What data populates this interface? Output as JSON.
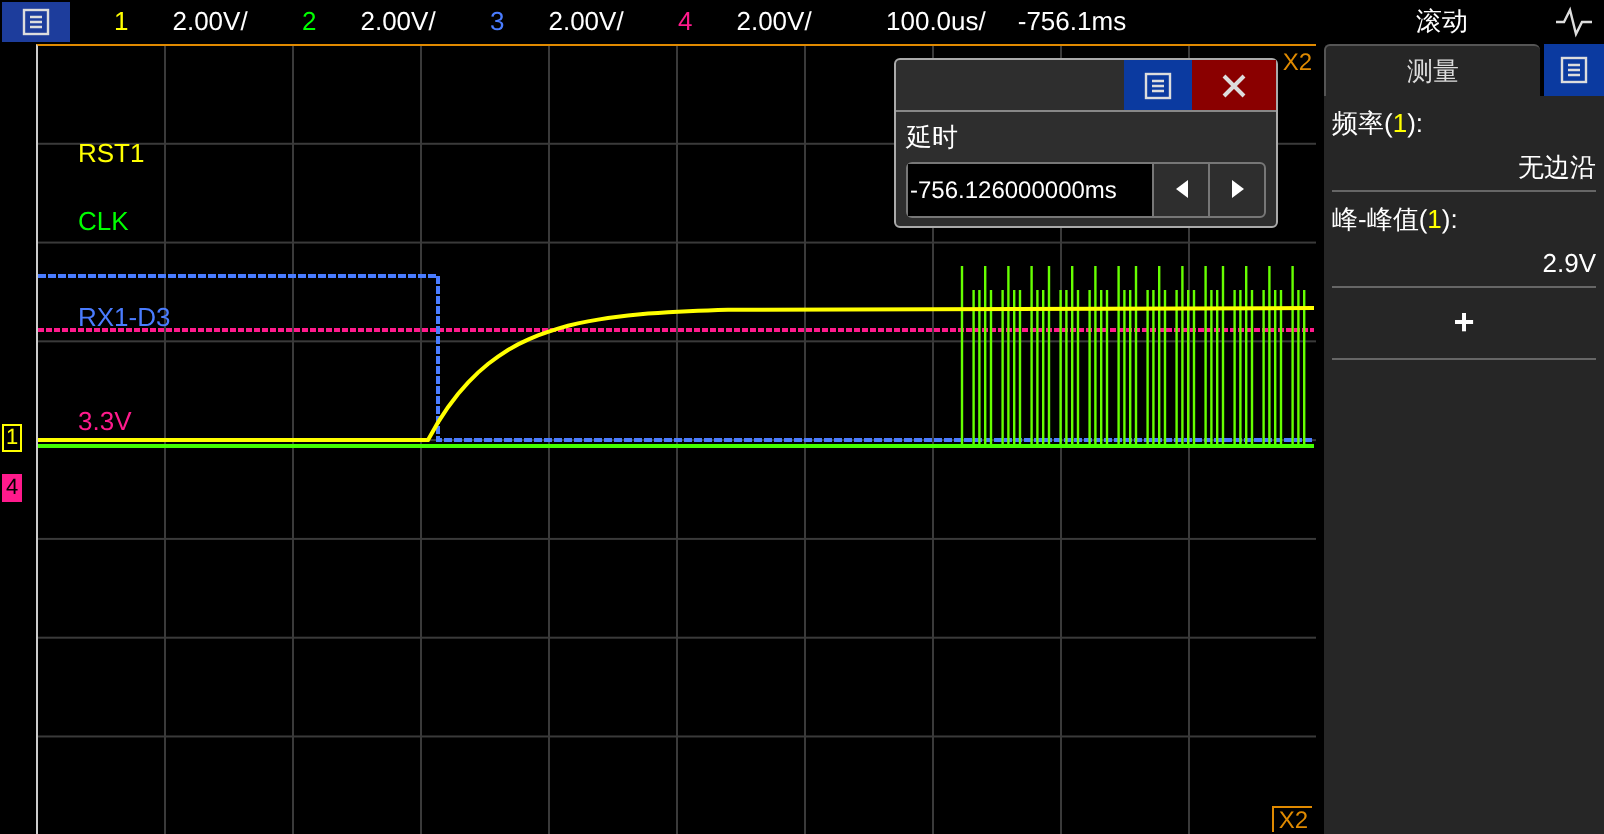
{
  "top_bar": {
    "channels": [
      {
        "number": "1",
        "scale": "2.00V/",
        "color": "#ffff00"
      },
      {
        "number": "2",
        "scale": "2.00V/",
        "color": "#00ff00"
      },
      {
        "number": "3",
        "scale": "2.00V/",
        "color": "#4a7cff"
      },
      {
        "number": "4",
        "scale": "2.00V/",
        "color": "#ff1a8c"
      }
    ],
    "timebase": "100.0us/",
    "delay": "-756.1ms",
    "mode": "滚动"
  },
  "plot": {
    "labels": [
      {
        "text": "RST1",
        "color": "#ffff00"
      },
      {
        "text": "CLK",
        "color": "#00ff00"
      },
      {
        "text": "RX1-D3",
        "color": "#4a7cff"
      },
      {
        "text": "3.3V",
        "color": "#ff1a8c"
      }
    ],
    "markers": [
      {
        "text": "1",
        "color": "#ffff00"
      },
      {
        "text": "4",
        "color": "#ff1a8c"
      }
    ],
    "cursor_top": "X2",
    "cursor_bottom": "X2"
  },
  "delay_dialog": {
    "label": "延时",
    "value": "-756.126000000ms"
  },
  "measure_panel": {
    "title": "测量",
    "items": [
      {
        "prefix": "频率(",
        "channel": "1",
        "suffix": "):",
        "value": "无边沿"
      },
      {
        "prefix": "峰-峰值(",
        "channel": "1",
        "suffix": "):",
        "value": "2.9V"
      }
    ],
    "add": "+"
  }
}
